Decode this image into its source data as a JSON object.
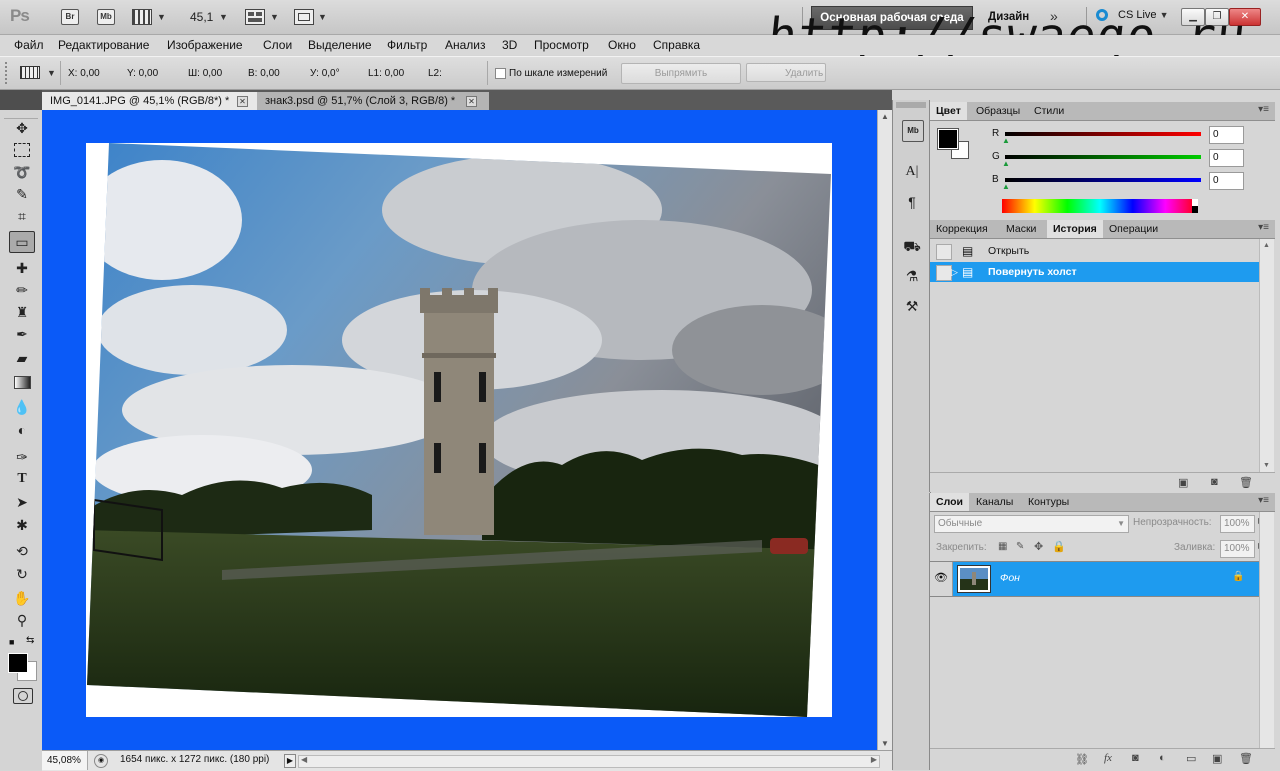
{
  "appbar": {
    "logo": "Ps",
    "bridge_label": "Br",
    "minibridge_label": "Mb",
    "zoom_value": "45,1",
    "workspace_active": "Основная рабочая среда",
    "workspace_other": "Дизайн",
    "cs_live": "CS Live"
  },
  "watermark": "http://swaego.ru",
  "menu": [
    "Файл",
    "Редактирование",
    "Изображение",
    "Слои",
    "Выделение",
    "Фильтр",
    "Анализ",
    "3D",
    "Просмотр",
    "Окно",
    "Справка"
  ],
  "options": {
    "x": "X: 0,00",
    "y": "Y: 0,00",
    "w": "Ш: 0,00",
    "h": "В: 0,00",
    "angle": "У: 0,0°",
    "l1": "L1: 0,00",
    "l2": "L2:",
    "scale_check": "По шкале измерений",
    "straighten": "Выпрямить",
    "clear": "Удалить"
  },
  "tabs": [
    {
      "label": "IMG_0141.JPG @ 45,1% (RGB/8*) *",
      "active": true
    },
    {
      "label": "знак3.psd @ 51,7% (Слой 3, RGB/8) *",
      "active": false
    }
  ],
  "status": {
    "zoom": "45,08%",
    "doc_info": "1654 пикс. x 1272 пикс. (180 ppi)"
  },
  "color_panel": {
    "tabs": [
      "Цвет",
      "Образцы",
      "Стили"
    ],
    "r_label": "R",
    "g_label": "G",
    "b_label": "B",
    "r_value": "0",
    "g_value": "0",
    "b_value": "0"
  },
  "history_panel": {
    "tabs": [
      "Коррекция",
      "Маски",
      "История",
      "Операции"
    ],
    "items": [
      "Открыть",
      "Повернуть холст"
    ],
    "selected_index": 1
  },
  "layers_panel": {
    "tabs": [
      "Слои",
      "Каналы",
      "Контуры"
    ],
    "blend_mode": "Обычные",
    "opacity_label": "Непрозрачность:",
    "opacity_value": "100%",
    "lock_label": "Закрепить:",
    "fill_label": "Заливка:",
    "fill_value": "100%",
    "layer_name": "Фон"
  },
  "colors": {
    "canvas_bg": "#0a5af8",
    "selection": "#1e9bef"
  }
}
